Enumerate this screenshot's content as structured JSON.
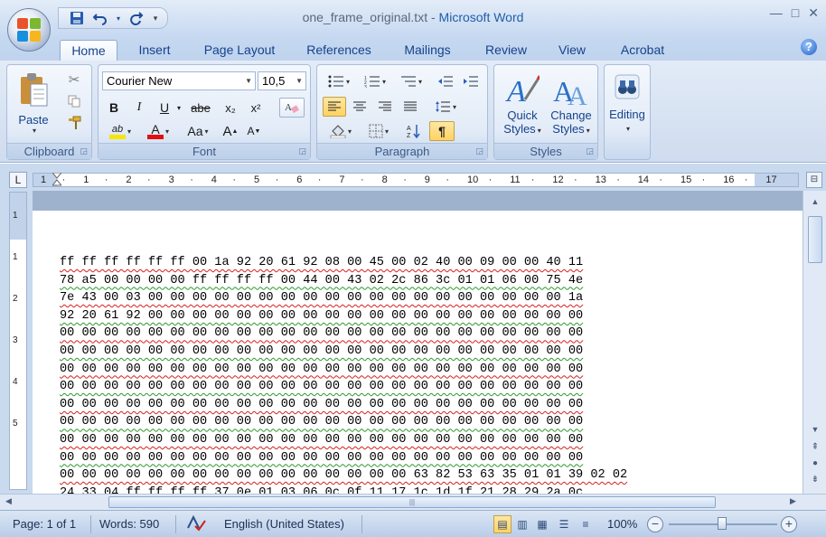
{
  "window": {
    "doc_name": "one_frame_original.txt",
    "separator": " - ",
    "app_name": "Microsoft Word",
    "controls": [
      "—",
      "□",
      "✕"
    ]
  },
  "quick_access": {
    "save": "save-icon",
    "undo": "undo-icon",
    "redo": "redo-icon",
    "customize": "▾"
  },
  "tabs": [
    {
      "label": "Home",
      "active": true
    },
    {
      "label": "Insert"
    },
    {
      "label": "Page Layout"
    },
    {
      "label": "References"
    },
    {
      "label": "Mailings"
    },
    {
      "label": "Review"
    },
    {
      "label": "View"
    },
    {
      "label": "Acrobat"
    }
  ],
  "clipboard": {
    "label": "Clipboard",
    "paste": "Paste"
  },
  "font": {
    "label": "Font",
    "name": "Courier New",
    "size": "10,5",
    "bold": "B",
    "italic": "I",
    "underline": "U",
    "strike": "abe",
    "subscript": "x₂",
    "superscript": "x²",
    "change_case": "Aa",
    "grow": "A",
    "shrink": "A",
    "highlight_color": "#f6e600",
    "font_color": "#e01010"
  },
  "paragraph": {
    "label": "Paragraph",
    "pilcrow": "¶"
  },
  "styles": {
    "label": "Styles",
    "quick": "Quick",
    "quick2": "Styles",
    "change": "Change",
    "change2": "Styles"
  },
  "editing": {
    "label": "Editing"
  },
  "ruler": {
    "h_numbers": [
      "1",
      "·",
      "1",
      "·",
      "2",
      "·",
      "3",
      "·",
      "4",
      "·",
      "5",
      "·",
      "6",
      "·",
      "7",
      "·",
      "8",
      "·",
      "9",
      "·",
      "10",
      "·",
      "11",
      "·",
      "12",
      "·",
      "13",
      "·",
      "14",
      "·",
      "15",
      "·",
      "16",
      "·",
      "17"
    ],
    "v_numbers": [
      "1",
      "1",
      "2",
      "3",
      "4",
      "5"
    ]
  },
  "document": {
    "lines": [
      "ff ff ff ff ff ff 00 1a 92 20 61 92 08 00 45 00 02 40 00 09 00 00 40 11",
      "78 a5 00 00 00 00 ff ff ff ff 00 44 00 43 02 2c 86 3c 01 01 06 00 75 4e",
      "7e 43 00 03 00 00 00 00 00 00 00 00 00 00 00 00 00 00 00 00 00 00 00 1a",
      "92 20 61 92 00 00 00 00 00 00 00 00 00 00 00 00 00 00 00 00 00 00 00 00",
      "00 00 00 00 00 00 00 00 00 00 00 00 00 00 00 00 00 00 00 00 00 00 00 00",
      "00 00 00 00 00 00 00 00 00 00 00 00 00 00 00 00 00 00 00 00 00 00 00 00",
      "00 00 00 00 00 00 00 00 00 00 00 00 00 00 00 00 00 00 00 00 00 00 00 00",
      "00 00 00 00 00 00 00 00 00 00 00 00 00 00 00 00 00 00 00 00 00 00 00 00",
      "00 00 00 00 00 00 00 00 00 00 00 00 00 00 00 00 00 00 00 00 00 00 00 00",
      "00 00 00 00 00 00 00 00 00 00 00 00 00 00 00 00 00 00 00 00 00 00 00 00",
      "00 00 00 00 00 00 00 00 00 00 00 00 00 00 00 00 00 00 00 00 00 00 00 00",
      "00 00 00 00 00 00 00 00 00 00 00 00 00 00 00 00 00 00 00 00 00 00 00 00",
      "00 00 00 00 00 00 00 00 00 00 00 00 00 00 00 00 63 82 53 63 35 01 01 39 02 02",
      "24 33 04 ff ff ff ff 37 0e 01 03 06 0c 0f 11 17 1c 1d 1f 21 28 29 2a 0c"
    ]
  },
  "status": {
    "page": "Page: 1 of 1",
    "words": "Words: 590",
    "language": "English (United States)",
    "zoom": "100%",
    "zoom_minus": "−",
    "zoom_plus": "+"
  }
}
